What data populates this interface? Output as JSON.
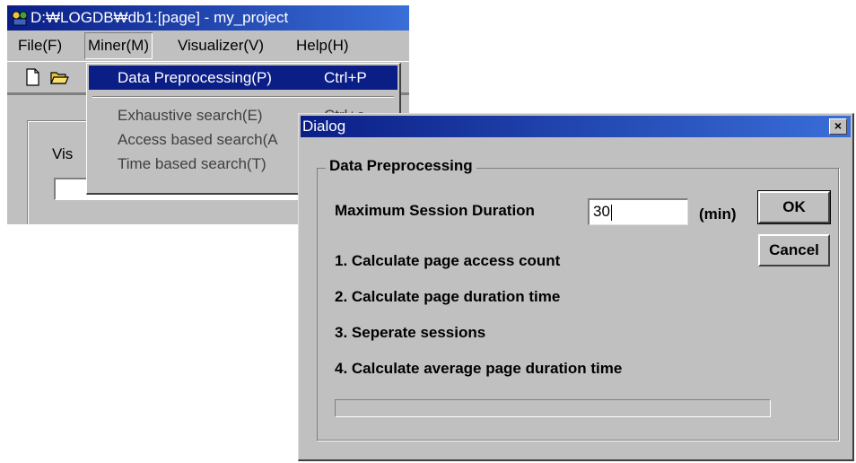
{
  "main_window": {
    "title": "D:₩LOGDB₩db1:[page] - my_project",
    "visible_label_fragment": "Vis"
  },
  "menubar": {
    "items": [
      "File(F)",
      "Miner(M)",
      "Visualizer(V)",
      "Help(H)"
    ]
  },
  "miner_menu": {
    "items": [
      {
        "label": "Data Preprocessing(P)",
        "accel": "Ctrl+P",
        "selected": true
      },
      {
        "label": "Exhaustive search(E)",
        "accel": "Ctrl+e",
        "selected": false
      },
      {
        "label": "Access based search(A",
        "accel": "",
        "selected": false
      },
      {
        "label": "Time based search(T)",
        "accel": "",
        "selected": false
      }
    ]
  },
  "dialog": {
    "title": "Dialog",
    "close_glyph": "×",
    "group_caption": "Data Preprocessing",
    "duration_label": "Maximum Session Duration",
    "duration_value": "30",
    "duration_unit": "(min)",
    "ok_label": "OK",
    "cancel_label": "Cancel",
    "steps": [
      "1. Calculate page access count",
      "2. Calculate page duration time",
      "3. Seperate sessions",
      "4. Calculate average page duration time"
    ],
    "progress": 0
  },
  "icons": {
    "app": "app-icon",
    "new": "new-file-icon",
    "open": "open-folder-icon",
    "close": "close-icon"
  }
}
